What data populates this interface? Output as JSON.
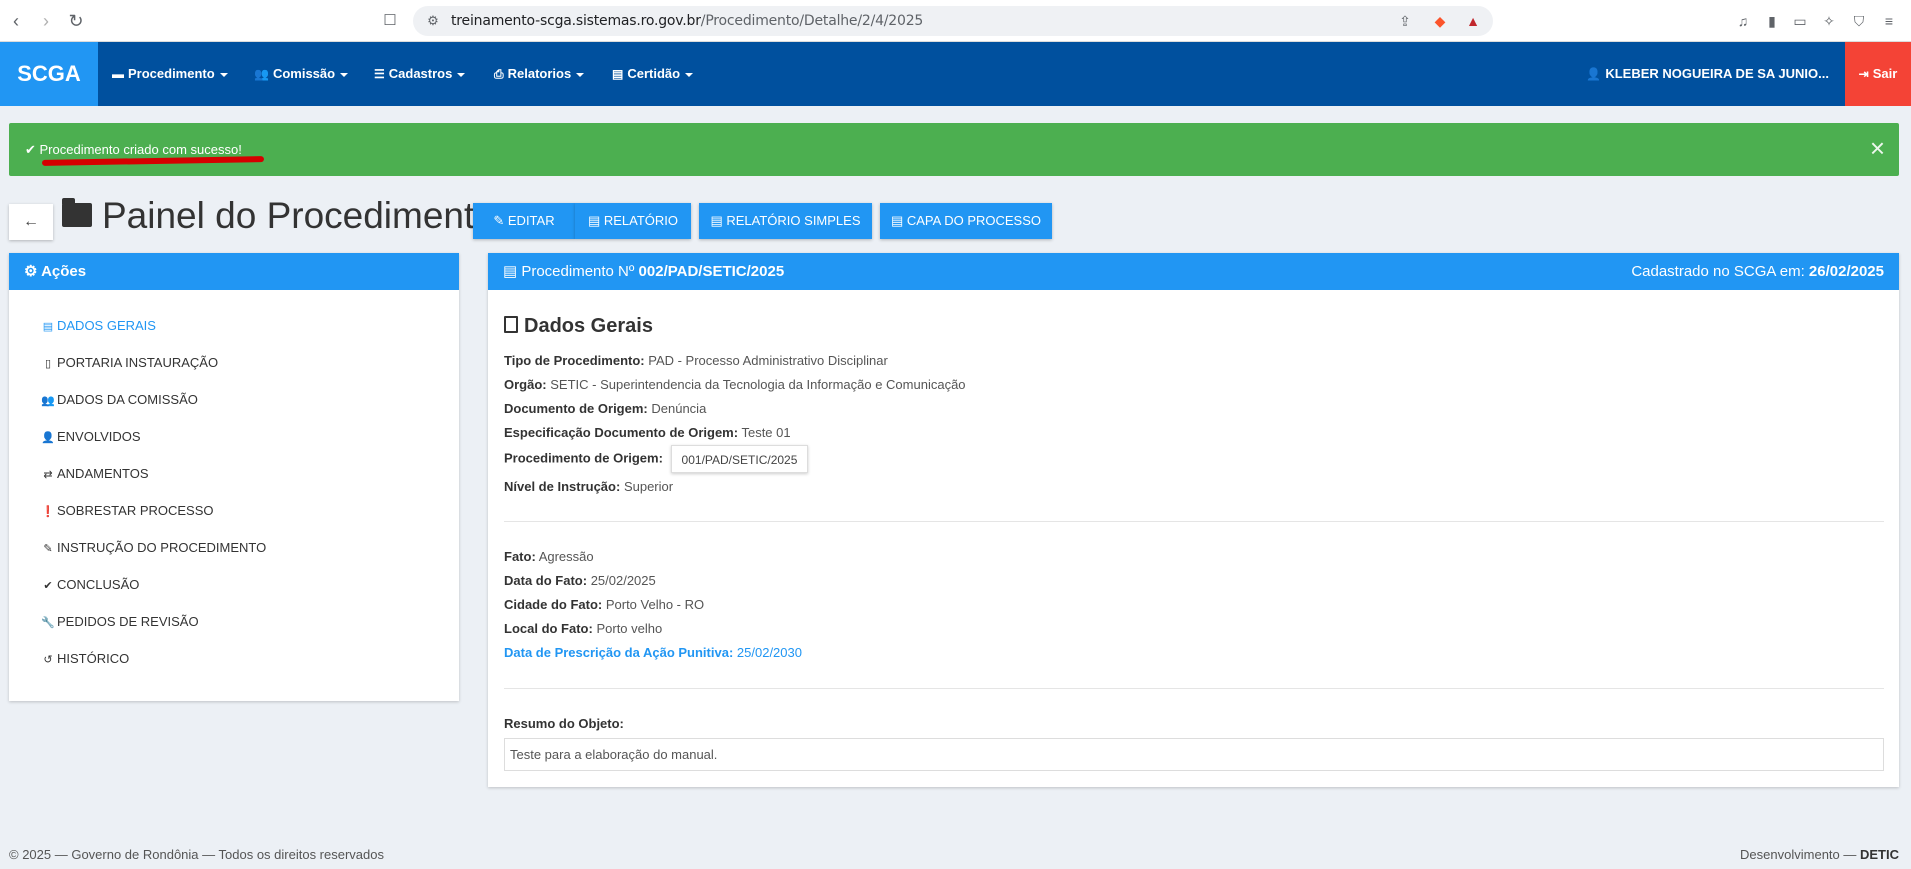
{
  "browser": {
    "url_domain": "treinamento-scga.sistemas.ro.gov.br",
    "url_path": "/Procedimento/Detalhe/2/4/2025",
    "brave_badge": "1"
  },
  "navbar": {
    "brand": "SCGA",
    "items": [
      {
        "label": "Procedimento",
        "icon": "folder-icon"
      },
      {
        "label": "Comissão",
        "icon": "users-icon"
      },
      {
        "label": "Cadastros",
        "icon": "list-icon"
      },
      {
        "label": "Relatorios",
        "icon": "print-icon"
      },
      {
        "label": "Certidão",
        "icon": "file-icon"
      }
    ],
    "user": "KLEBER NOGUEIRA DE SA JUNIO...",
    "logout": "Sair"
  },
  "alert": {
    "message": "Procedimento criado com sucesso!",
    "close": "×"
  },
  "page": {
    "title": "Painel do Procedimento",
    "buttons": {
      "editar": "EDITAR",
      "relatorio": "RELATÓRIO",
      "relatorio_simples": "RELATÓRIO SIMPLES",
      "capa": "CAPA DO PROCESSO"
    }
  },
  "acoes": {
    "title": "Ações",
    "items": [
      {
        "label": "DADOS GERAIS",
        "icon": "list-alt-icon",
        "active": true
      },
      {
        "label": "PORTARIA INSTAURAÇÃO",
        "icon": "file-icon"
      },
      {
        "label": "DADOS DA COMISSÃO",
        "icon": "users-icon"
      },
      {
        "label": "ENVOLVIDOS",
        "icon": "user-icon"
      },
      {
        "label": "ANDAMENTOS",
        "icon": "exchange-icon"
      },
      {
        "label": "SOBRESTAR PROCESSO",
        "icon": "exclamation-circle-icon"
      },
      {
        "label": "INSTRUÇÃO DO PROCEDIMENTO",
        "icon": "edit-icon"
      },
      {
        "label": "CONCLUSÃO",
        "icon": "check-icon"
      },
      {
        "label": "PEDIDOS DE REVISÃO",
        "icon": "wrench-icon"
      },
      {
        "label": "HISTÓRICO",
        "icon": "history-icon"
      }
    ]
  },
  "procedimento": {
    "header_prefix": "Procedimento Nº",
    "numero": "002/PAD/SETIC/2025",
    "cadastrado_label": "Cadastrado no SCGA em:",
    "cadastrado_data": "26/02/2025",
    "section_title": "Dados Gerais",
    "tipo_label": "Tipo de Procedimento:",
    "tipo_value": "PAD - Processo Administrativo Disciplinar",
    "orgao_label": "Orgão:",
    "orgao_value": "SETIC - Superintendencia da Tecnologia da Informação e Comunicação",
    "doc_origem_label": "Documento de Origem:",
    "doc_origem_value": "Denúncia",
    "espec_label": "Especificação Documento de Origem:",
    "espec_value": "Teste 01",
    "proc_origem_label": "Procedimento de Origem:",
    "proc_origem_value": "001/PAD/SETIC/2025",
    "nivel_label": "Nível de Instrução:",
    "nivel_value": "Superior",
    "fato_label": "Fato:",
    "fato_value": "Agressão",
    "data_fato_label": "Data do Fato:",
    "data_fato_value": "25/02/2025",
    "cidade_label": "Cidade do Fato:",
    "cidade_value": "Porto Velho - RO",
    "local_label": "Local do Fato:",
    "local_value": "Porto velho",
    "prescricao_label": "Data de Prescrição da Ação Punitiva:",
    "prescricao_value": "25/02/2030",
    "resumo_label": "Resumo do Objeto:",
    "resumo_value": "Teste para a elaboração do manual."
  },
  "footer": {
    "left": "© 2025 — Governo de Rondônia — Todos os direitos reservados",
    "right_prefix": "Desenvolvimento —",
    "right_bold": "DETIC"
  },
  "colors": {
    "navbar": "#00509e",
    "brand": "#2196f3",
    "alert_success": "#4caf50",
    "logout": "#f44336",
    "accent": "#2196f3"
  }
}
